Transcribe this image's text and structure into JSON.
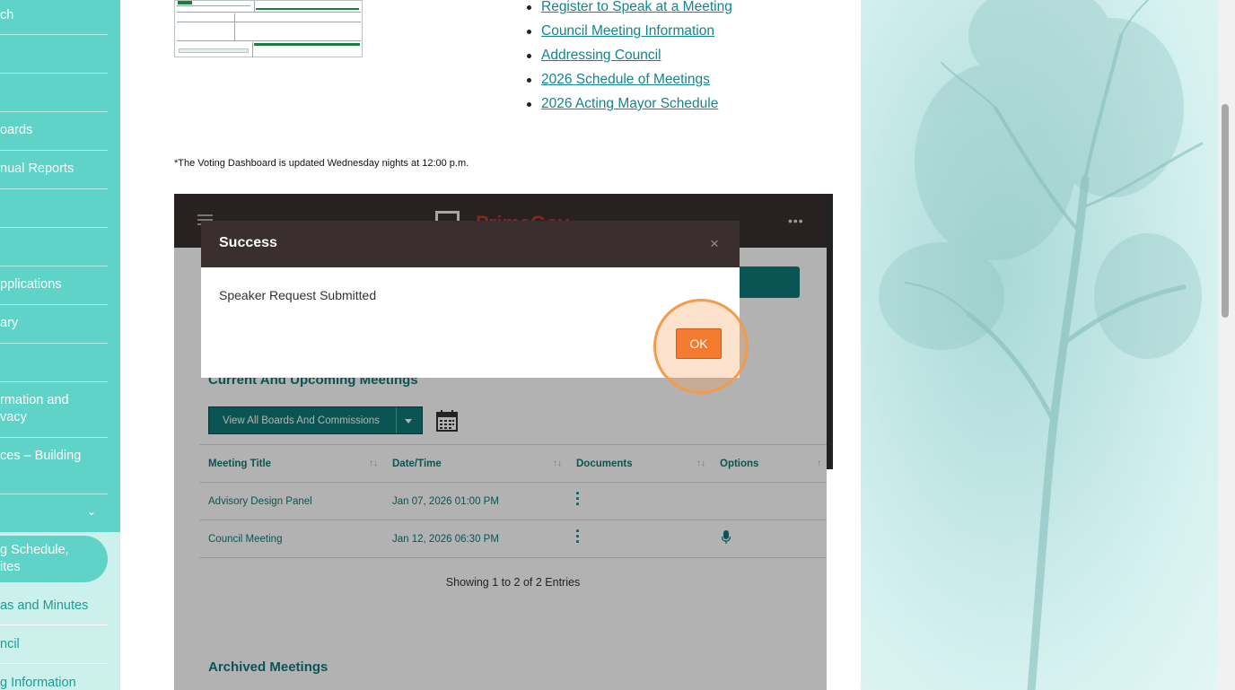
{
  "sidebar": {
    "items": [
      {
        "label": "ch"
      },
      {
        "label": ""
      },
      {
        "label": ""
      },
      {
        "label": "oards"
      },
      {
        "label": "nual Reports"
      },
      {
        "label": ""
      },
      {
        "label": ""
      },
      {
        "label": "pplications"
      },
      {
        "label": "ary"
      },
      {
        "label": ""
      },
      {
        "label": "rmation and"
      },
      {
        "label": "vacy"
      },
      {
        "label": "ces – Building"
      },
      {
        "label": ""
      }
    ],
    "expand_icon": "chevron-down-icon",
    "sub_items": [
      {
        "label": "g Schedule,"
      },
      {
        "label": "ites"
      },
      {
        "label": "as and Minutes"
      },
      {
        "label": "ncil"
      },
      {
        "label": "g Information"
      }
    ]
  },
  "links": [
    "Register to Speak at a Meeting",
    "Council Meeting Information",
    "Addressing Council",
    "2026 Schedule of Meetings",
    "2026 Acting Mayor Schedule"
  ],
  "note": "*The Voting Dashboard is updated Wednesday nights at 12:00 p.m.",
  "embed": {
    "logo_text": "PrimeGov",
    "section_current": "Current And Upcoming Meetings",
    "filter_value": "View All Boards And Commissions",
    "columns": [
      "Meeting Title",
      "Date/Time",
      "Documents",
      "Options"
    ],
    "rows": [
      {
        "title": "Advisory Design Panel",
        "datetime": "Jan 07, 2026 01:00 PM"
      },
      {
        "title": "Council Meeting",
        "datetime": "Jan 12, 2026 06:30 PM"
      }
    ],
    "entries_text": "Showing 1 to 2 of 2 Entries",
    "section_archived": "Archived Meetings"
  },
  "modal": {
    "title": "Success",
    "close": "×",
    "message": "Speaker Request Submitted",
    "ok_label": "OK"
  },
  "colors": {
    "sidebar": "#5fd3c7",
    "teal": "#0f7a77",
    "ok_button": "#f47a2f",
    "link": "#14848f"
  }
}
